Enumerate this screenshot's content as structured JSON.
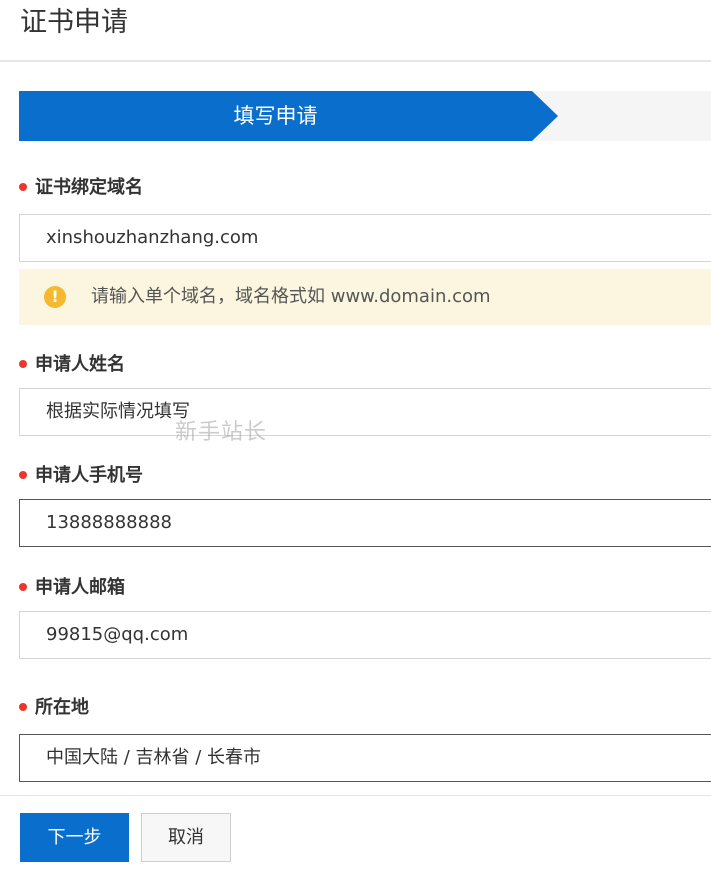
{
  "header": {
    "title": "证书申请"
  },
  "steps": {
    "active_label": "填写申请"
  },
  "form": {
    "domain": {
      "label": "证书绑定域名",
      "value": "xinshouzhanzhang.com",
      "hint": "请输入单个域名，域名格式如 www.domain.com",
      "hint_icon": "warning-icon"
    },
    "applicant_name": {
      "label": "申请人姓名",
      "value": "根据实际情况填写"
    },
    "applicant_phone": {
      "label": "申请人手机号",
      "value": "13888888888"
    },
    "applicant_email": {
      "label": "申请人邮箱",
      "value": "99815@qq.com"
    },
    "location": {
      "label": "所在地",
      "value": "中国大陆 / 吉林省 / 长春市"
    }
  },
  "watermark": "新手站长",
  "footer": {
    "next_label": "下一步",
    "cancel_label": "取消"
  },
  "colors": {
    "primary": "#0a6fcc",
    "required_dot": "#e8382f",
    "hint_bg": "#fcf6e1",
    "warning": "#f5b82e"
  }
}
